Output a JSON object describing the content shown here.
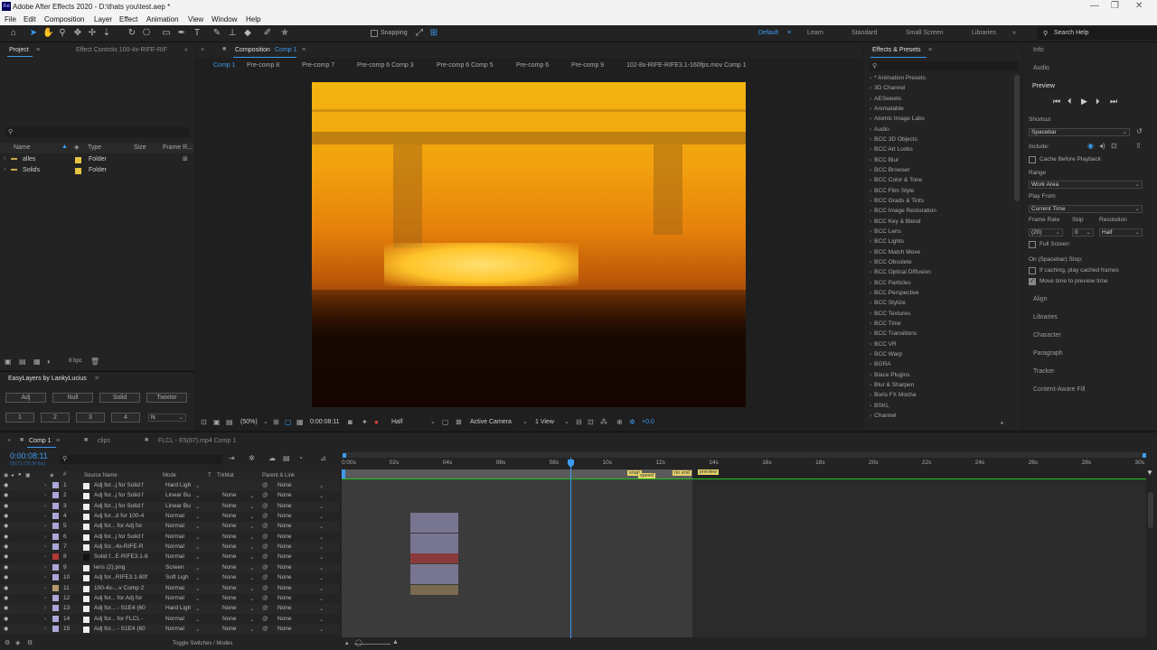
{
  "app": {
    "title": "Adobe After Effects 2020 - D:\\thats you\\test.aep *",
    "logo": "Ae"
  },
  "menu": [
    "File",
    "Edit",
    "Composition",
    "Layer",
    "Effect",
    "Animation",
    "View",
    "Window",
    "Help"
  ],
  "toolbar": {
    "snapping": "Snapping",
    "search_help": "Search Help"
  },
  "workspaces": [
    "Default",
    "Learn",
    "Standard",
    "Small Screen",
    "Libraries"
  ],
  "project": {
    "tab_project": "Project",
    "tab_effect_controls": "Effect Controls 100-4x-RIFE-RIF",
    "columns": {
      "name": "Name",
      "type": "Type",
      "size": "Size",
      "frame_rate": "Frame R..."
    },
    "items": [
      {
        "name": "alles",
        "type": "Folder",
        "color": "#e7c343"
      },
      {
        "name": "Solids",
        "type": "Folder",
        "color": "#e7c343"
      }
    ],
    "bpc": "8 bpc"
  },
  "easylayers": {
    "title": "EasyLayers by LankyLucius",
    "buttons": [
      "Adj",
      "Null",
      "Solid",
      "Twixtor"
    ],
    "nums": [
      "1",
      "2",
      "3",
      "4"
    ],
    "mode": "N"
  },
  "composition": {
    "panel_title": "Composition",
    "comp_name": "Comp 1",
    "breadcrumbs": [
      "Comp 1",
      "Pre-comp 8",
      "Pre-comp 7",
      "Pre-comp 6 Comp 3",
      "Pre-comp 6 Comp 5",
      "Pre-comp 6",
      "Pre-comp 9",
      "102-8x-RIFE-RIFE3.1-160fps.mov Comp 1"
    ],
    "zoom": "(50%)",
    "timecode": "0:00:08:11",
    "resolution": "Half",
    "camera": "Active Camera",
    "views": "1 View",
    "exposure": "+0.0"
  },
  "effects": {
    "title": "Effects & Presets",
    "list": [
      "* Animation Presets",
      "3D Channel",
      "AESweets",
      "Animatable",
      "Atomic Image Labs",
      "Audio",
      "BCC 3D Objects",
      "BCC Art Looks",
      "BCC Blur",
      "BCC Browser",
      "BCC Color & Tone",
      "BCC Film Style",
      "BCC Grads & Tints",
      "BCC Image Restoration",
      "BCC Key & Blend",
      "BCC Lens",
      "BCC Lights",
      "BCC Match Move",
      "BCC Obsolete",
      "BCC Optical Diffusion",
      "BCC Particles",
      "BCC Perspective",
      "BCC Stylize",
      "BCC Textures",
      "BCC Time",
      "BCC Transitions",
      "BCC VR",
      "BCC Warp",
      "BGRA",
      "Blace Plugins",
      "Blur & Sharpen",
      "Boris FX Mocha",
      "BSKL",
      "Channel"
    ]
  },
  "right": {
    "info": "Info",
    "audio": "Audio",
    "preview": "Preview",
    "shortcut_label": "Shortcut",
    "shortcut": "Spacebar",
    "include": "Include:",
    "cache_before": "Cache Before Playback",
    "range_label": "Range",
    "range": "Work Area",
    "play_from_label": "Play From",
    "play_from": "Current Time",
    "frame_rate_label": "Frame Rate",
    "skip_label": "Skip",
    "resolution_label": "Resolution",
    "frame_rate": "(20)",
    "skip": "0",
    "resolution": "Half",
    "full_screen": "Full Screen",
    "on_stop": "On (Spacebar) Stop:",
    "if_caching": "If caching, play cached frames",
    "move_time": "Move time to preview time",
    "panels": [
      "Align",
      "Libraries",
      "Character",
      "Paragraph",
      "Tracker",
      "Content-Aware Fill"
    ]
  },
  "timeline": {
    "tabs": [
      "Comp 1",
      "clips",
      "FLCL - E5(87).mp4 Comp 1"
    ],
    "timecode": "0:00:08:11",
    "frame_info": "00171 (20.00 fps)",
    "columns": {
      "num": "#",
      "source": "Source Name",
      "mode": "Mode",
      "t": "T",
      "trkmat": "TrkMat",
      "parent": "Parent & Link"
    },
    "ruler": [
      "0:00s",
      "02s",
      "04s",
      "06s",
      "08s",
      "10s",
      "12s",
      "14s",
      "16s",
      "18s",
      "20s",
      "22s",
      "24s",
      "26s",
      "28s",
      "30s"
    ],
    "markers": [
      "snap",
      "speed",
      "no end",
      "preview"
    ],
    "toggle": "Toggle Switches / Modes",
    "layers": [
      {
        "n": "1",
        "name": "Adj for...j for Solid f",
        "mode": "Hard Ligh",
        "trk": "",
        "parent": "None",
        "color": "#a9a7d8"
      },
      {
        "n": "2",
        "name": "Adj for...j for Solid f",
        "mode": "Linear Bu",
        "trk": "None",
        "parent": "None",
        "color": "#a9a7d8"
      },
      {
        "n": "3",
        "name": "Adj for...j for Solid f",
        "mode": "Linear Bu",
        "trk": "None",
        "parent": "None",
        "color": "#a9a7d8"
      },
      {
        "n": "4",
        "name": "Adj for...d for 100-4",
        "mode": "Normal",
        "trk": "None",
        "parent": "None",
        "color": "#a9a7d8"
      },
      {
        "n": "5",
        "name": "Adj for... for Adj for",
        "mode": "Normal",
        "trk": "None",
        "parent": "None",
        "color": "#a9a7d8"
      },
      {
        "n": "6",
        "name": "Adj for...j for Solid f",
        "mode": "Normal",
        "trk": "None",
        "parent": "None",
        "color": "#a9a7d8"
      },
      {
        "n": "7",
        "name": "Adj for...4x-RIFE-R",
        "mode": "Normal",
        "trk": "None",
        "parent": "None",
        "color": "#a9a7d8"
      },
      {
        "n": "8",
        "name": "Solid f...E-RIFE3.1-8",
        "mode": "Normal",
        "trk": "None",
        "parent": "None",
        "color": "#b53838"
      },
      {
        "n": "9",
        "name": "lens (2).png",
        "mode": "Screen",
        "trk": "None",
        "parent": "None",
        "color": "#a9a7d8"
      },
      {
        "n": "10",
        "name": "Adj for...RIFE3.1-80f",
        "mode": "Soft Ligh",
        "trk": "None",
        "parent": "None",
        "color": "#a9a7d8"
      },
      {
        "n": "11",
        "name": "100-4x-...v Comp 2",
        "mode": "Normal",
        "trk": "None",
        "parent": "None",
        "color": "#b59a6e"
      },
      {
        "n": "12",
        "name": "Adj for... for Adj for",
        "mode": "Normal",
        "trk": "None",
        "parent": "None",
        "color": "#a9a7d8"
      },
      {
        "n": "13",
        "name": "Adj for... - S1E4 (60",
        "mode": "Hard Ligh",
        "trk": "None",
        "parent": "None",
        "color": "#a9a7d8"
      },
      {
        "n": "14",
        "name": "Adj for... for FLCL -",
        "mode": "Normal",
        "trk": "None",
        "parent": "None",
        "color": "#a9a7d8"
      },
      {
        "n": "15",
        "name": "Adj for... - S1E4 (60",
        "mode": "Normal",
        "trk": "None",
        "parent": "None",
        "color": "#a9a7d8"
      }
    ]
  }
}
